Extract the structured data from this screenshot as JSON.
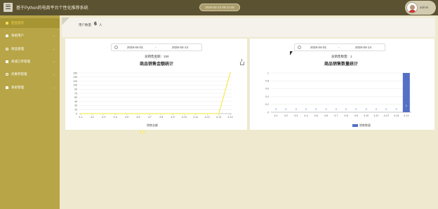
{
  "header": {
    "menu_icon": "menu-icon",
    "title": "基于Python的电商平台个性化推荐系统",
    "clock": "2025-04-14 09:13:45",
    "user": {
      "avatar_icon": "user-avatar",
      "name": "admin"
    }
  },
  "sidebar": {
    "items": [
      {
        "label": "后台首页",
        "icon": "home-icon",
        "active": true
      },
      {
        "label": "系统用户",
        "icon": "user-icon",
        "active": false
      },
      {
        "label": "商品管理",
        "icon": "gear-icon",
        "active": false
      },
      {
        "label": "商城订单管理",
        "icon": "doc-icon",
        "active": false
      },
      {
        "label": "优惠券管理",
        "icon": "gear-icon",
        "active": false
      },
      {
        "label": "系统管理",
        "icon": "doc-icon",
        "active": false
      }
    ]
  },
  "summary": {
    "label": "用户数量",
    "value": "6",
    "unit": "人"
  },
  "sales_card": {
    "date_start": "2025-04-01",
    "date_sep": "-",
    "date_end": "2025-04-14",
    "total": "总销售金额：150",
    "legend": "销售金额",
    "color": "#f5e633"
  },
  "quantity_card": {
    "date_start": "2025-04-01",
    "date_sep": "-",
    "date_end": "2025-04-14",
    "total": "总销售数量：1",
    "legend": "销售数量",
    "color": "#5470c6"
  },
  "chart_data": [
    {
      "type": "line",
      "title": "商品销售金额统计",
      "categories": [
        "4-1",
        "4-2",
        "4-3",
        "4-4",
        "4-5",
        "4-6",
        "4-7",
        "4-8",
        "4-9",
        "4-10",
        "4-11",
        "4-12",
        "4-13",
        "4-14"
      ],
      "series": [
        {
          "name": "销售金额",
          "values": [
            0,
            0,
            0,
            0,
            0,
            0,
            0,
            0,
            0,
            0,
            0,
            0,
            0,
            150
          ]
        }
      ],
      "yticks": [
        0,
        15,
        30,
        45,
        60,
        75,
        90,
        105,
        120,
        135,
        150
      ],
      "ylim": [
        0,
        150
      ],
      "grid": true,
      "legend": "bottom"
    },
    {
      "type": "bar",
      "title": "商品销售数量统计",
      "categories": [
        "4-1",
        "4-2",
        "4-3",
        "4-4",
        "4-5",
        "4-6",
        "4-7",
        "4-8",
        "4-9",
        "4-10",
        "4-11",
        "4-12",
        "4-13",
        "4-14"
      ],
      "series": [
        {
          "name": "销售数量",
          "values": [
            0,
            0,
            0,
            0,
            0,
            0,
            0,
            0,
            0,
            0,
            0,
            0,
            0,
            1
          ]
        }
      ],
      "yticks": [
        0,
        0.2,
        0.4,
        0.6,
        0.8,
        1
      ],
      "ylim": [
        0,
        1
      ],
      "grid": true,
      "legend": "bottom"
    }
  ]
}
